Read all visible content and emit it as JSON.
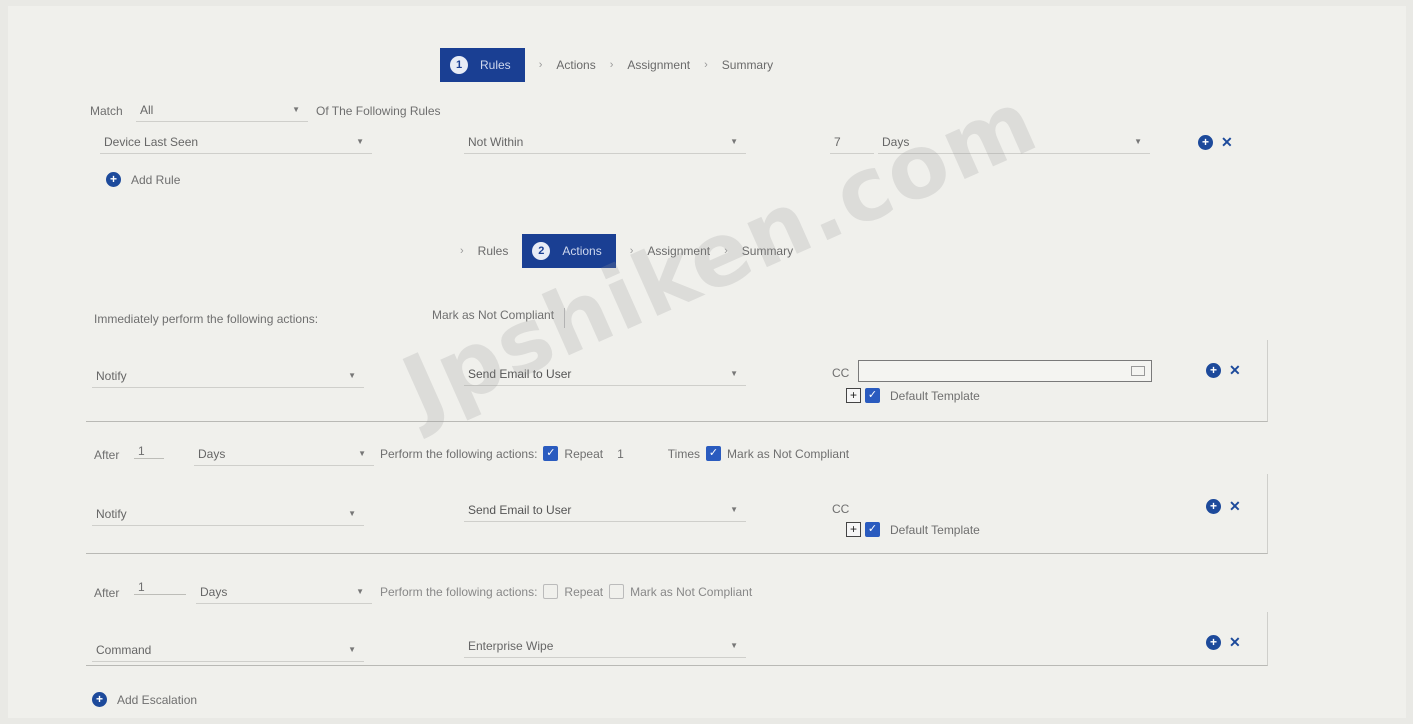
{
  "top_stepper": {
    "steps": [
      {
        "num": "1",
        "label": "Rules"
      },
      {
        "label": "Actions"
      },
      {
        "label": "Assignment"
      },
      {
        "label": "Summary"
      }
    ],
    "sep": "›"
  },
  "rules": {
    "match_label": "Match",
    "match_value": "All",
    "match_suffix": "Of The Following Rules",
    "rule": {
      "field": "Device Last Seen",
      "operator": "Not Within",
      "value": "7",
      "unit": "Days"
    },
    "add_rule_label": "Add Rule"
  },
  "second_stepper": {
    "steps": [
      {
        "label": "Rules"
      },
      {
        "num": "2",
        "label": "Actions"
      },
      {
        "label": "Assignment"
      },
      {
        "label": "Summary"
      }
    ],
    "sep": "›"
  },
  "actions": {
    "immediate_label": "Immediately perform the following actions:",
    "immediate_mark": "Mark as Not Compliant",
    "block1": {
      "type": "Notify",
      "action": "Send Email to User",
      "cc_label": "CC",
      "default_template": "Default Template"
    },
    "escalation1": {
      "after_label": "After",
      "after_value": "1",
      "unit": "Days",
      "perform_label": "Perform the following actions:",
      "repeat_label": "Repeat",
      "repeat_value": "1",
      "times_label": "Times",
      "mark_label": "Mark as Not Compliant",
      "type": "Notify",
      "action": "Send Email to User",
      "cc_label": "CC",
      "default_template": "Default Template"
    },
    "escalation2": {
      "after_label": "After",
      "after_value": "1",
      "unit": "Days",
      "perform_label": "Perform the following actions:",
      "repeat_label": "Repeat",
      "mark_label": "Mark as Not Compliant",
      "type": "Command",
      "action": "Enterprise Wipe"
    },
    "add_escalation_label": "Add Escalation"
  },
  "watermark": "Jpshiken.com",
  "colors": {
    "accent": "#1a3f93",
    "checkbox": "#2a5bbf",
    "background": "#f0f0ec"
  }
}
